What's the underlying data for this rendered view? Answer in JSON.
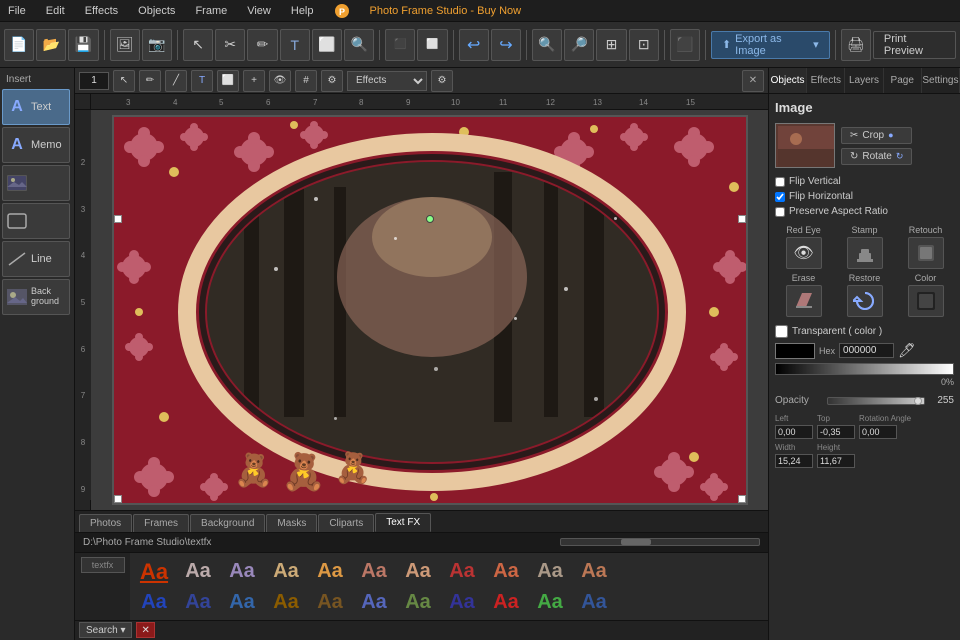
{
  "app": {
    "title": "Photo Frame Studio - Buy Now",
    "menu_items": [
      "File",
      "Edit",
      "Effects",
      "Objects",
      "Frame",
      "View",
      "Help"
    ]
  },
  "toolbar": {
    "export_label": "Export as Image",
    "print_label": "Print Preview"
  },
  "insert": {
    "label": "Insert",
    "tools": [
      {
        "id": "text",
        "label": "Text",
        "icon": "A"
      },
      {
        "id": "memo",
        "label": "Memo",
        "icon": "A"
      },
      {
        "id": "image",
        "label": "",
        "icon": "🖼"
      },
      {
        "id": "shape",
        "label": "",
        "icon": "⬜"
      },
      {
        "id": "line",
        "label": "Line",
        "icon": "╱"
      },
      {
        "id": "background",
        "label": "Back\nground",
        "icon": "🌄"
      }
    ]
  },
  "canvas": {
    "page_num": "1",
    "effects_label": "Effects",
    "ruler_unit": "cm"
  },
  "right_panel": {
    "tabs": [
      "Objects",
      "Effects",
      "Layers",
      "Page",
      "Settings"
    ],
    "active_tab": "Objects",
    "section_title": "Image",
    "crop_label": "Crop",
    "rotate_label": "Rotate",
    "flip_vertical_label": "Flip Vertical",
    "flip_horizontal_label": "Flip Horizontal",
    "preserve_aspect_label": "Preserve Aspect Ratio",
    "flip_vertical_checked": false,
    "flip_horizontal_checked": true,
    "preserve_aspect_checked": false,
    "red_eye_label": "Red Eye",
    "stamp_label": "Stamp",
    "retouch_label": "Retouch",
    "erase_label": "Erase",
    "restore_label": "Restore",
    "color_label": "Color",
    "transparent_label": "Transparent ( color )",
    "transparent_checked": false,
    "hex_label": "Hex",
    "hex_value": "000000",
    "pct_value": "0%",
    "opacity_label": "Opacity",
    "opacity_value": "255",
    "left_label": "Left",
    "top_label": "Top",
    "width_label": "Width",
    "height_label": "Height",
    "rotation_label": "Rotation Angle",
    "left_value": "0,00",
    "top_value": "-0,35",
    "width_value": "15,24",
    "height_value": "11,67",
    "rotation_value": "0,00"
  },
  "bottom_panel": {
    "tabs": [
      "Photos",
      "Frames",
      "Background",
      "Masks",
      "Cliparts",
      "Text FX"
    ],
    "active_tab": "Text FX",
    "file_path": "D:\\Photo Frame Studio\\textfx",
    "search_label": "Search ▾",
    "textfx_folder": "textfx",
    "textfx_items_row1": [
      {
        "text": "Aa",
        "color": "#cc3300",
        "style": "bold",
        "underline": true
      },
      {
        "text": "Aa",
        "color": "#aa99aa",
        "style": "bold"
      },
      {
        "text": "Aa",
        "color": "#8877aa",
        "style": "bold"
      },
      {
        "text": "Aa",
        "color": "#cc9966",
        "style": "bold"
      },
      {
        "text": "Aa",
        "color": "#dd8833",
        "style": "bold"
      },
      {
        "text": "Aa",
        "color": "#bb6655",
        "style": "bold"
      },
      {
        "text": "Aa",
        "color": "#cc8866",
        "style": "bold"
      },
      {
        "text": "Aa",
        "color": "#aa2222",
        "style": "bold"
      },
      {
        "text": "Aa",
        "color": "#cc5533",
        "style": "bold"
      },
      {
        "text": "Aa",
        "color": "#998877",
        "style": "bold"
      },
      {
        "text": "Aa",
        "color": "#aa6644",
        "style": "bold"
      }
    ],
    "textfx_items_row2": [
      {
        "text": "Aa",
        "color": "#2244aa",
        "style": "bold"
      },
      {
        "text": "Aa",
        "color": "#334488",
        "style": "bold"
      },
      {
        "text": "Aa",
        "color": "#336699",
        "style": "bold"
      },
      {
        "text": "Aa",
        "color": "#8b5c00",
        "style": "bold"
      },
      {
        "text": "Aa",
        "color": "#664411",
        "style": "bold"
      },
      {
        "text": "Aa",
        "color": "#5566aa",
        "style": "bold"
      },
      {
        "text": "Aa",
        "color": "#668833",
        "style": "bold"
      },
      {
        "text": "Aa",
        "color": "#333388",
        "style": "bold"
      },
      {
        "text": "Aa",
        "color": "#cc2222",
        "style": "bold"
      },
      {
        "text": "Aa",
        "color": "#44aa44",
        "style": "bold"
      },
      {
        "text": "Aa",
        "color": "#335599",
        "style": "bold"
      }
    ]
  }
}
